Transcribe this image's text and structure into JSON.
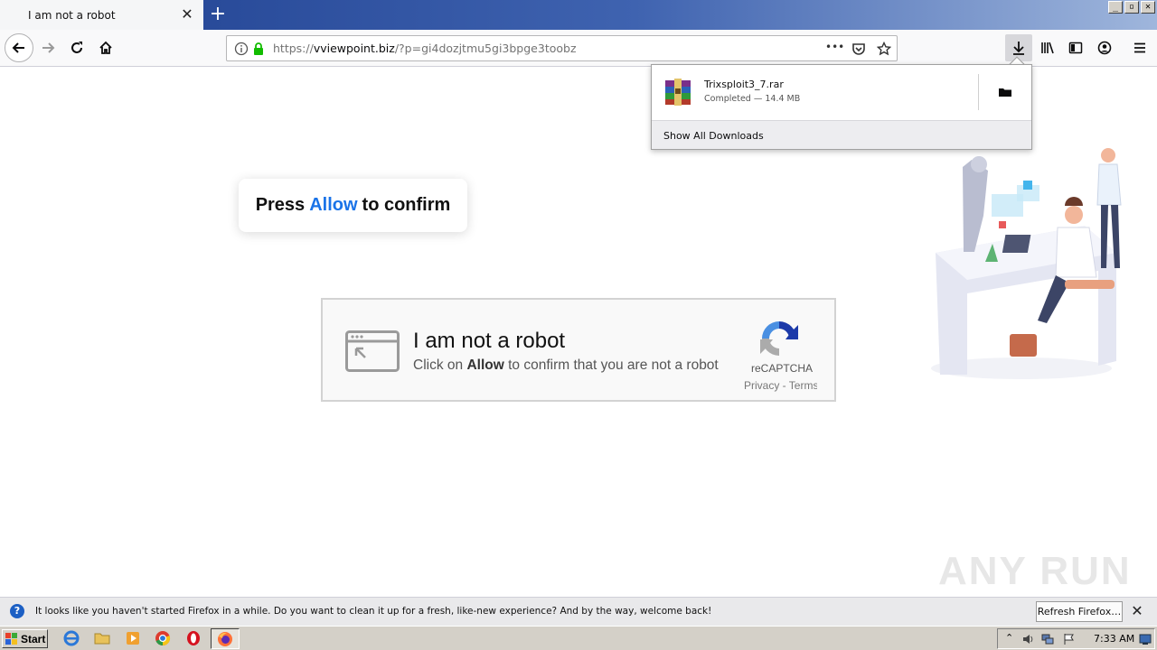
{
  "tab": {
    "title": "I am not a robot",
    "close": "✕",
    "new_tab": "+"
  },
  "window_buttons": {
    "minimize": "_",
    "restore": "▫",
    "close": "✕"
  },
  "urlbar": {
    "protocol": "https://",
    "host": "vviewpoint.biz",
    "path": "/?p=gi4dozjtmu5gi3bpge3toobz",
    "more": "•••"
  },
  "downloads_panel": {
    "file_name": "Trixsploit3_7.rar",
    "status": "Completed — 14.4 MB",
    "show_all": "Show All Downloads"
  },
  "page": {
    "press_pre": "Press",
    "press_allow": "Allow",
    "press_post": "to confirm",
    "captcha_title": "I am not a robot",
    "captcha_sub_pre": "Click on",
    "captcha_sub_allow": "Allow",
    "captcha_sub_post": "to confirm that you are not a robot",
    "captcha_brand": "reCAPTCHA",
    "captcha_privacy": "Privacy - Terms"
  },
  "watermark": "ANY RUN",
  "notification": {
    "icon": "?",
    "text": "It looks like you haven't started Firefox in a while. Do you want to clean it up for a fresh, like-new experience? And by the way, welcome back!",
    "button": "Refresh Firefox…",
    "close": "✕"
  },
  "taskbar": {
    "start": "Start",
    "clock": "7:33 AM"
  },
  "colors": {
    "allow_blue": "#1a73e8",
    "titlebar_start": "#1e3f8f",
    "secure_green": "#12bc00"
  }
}
